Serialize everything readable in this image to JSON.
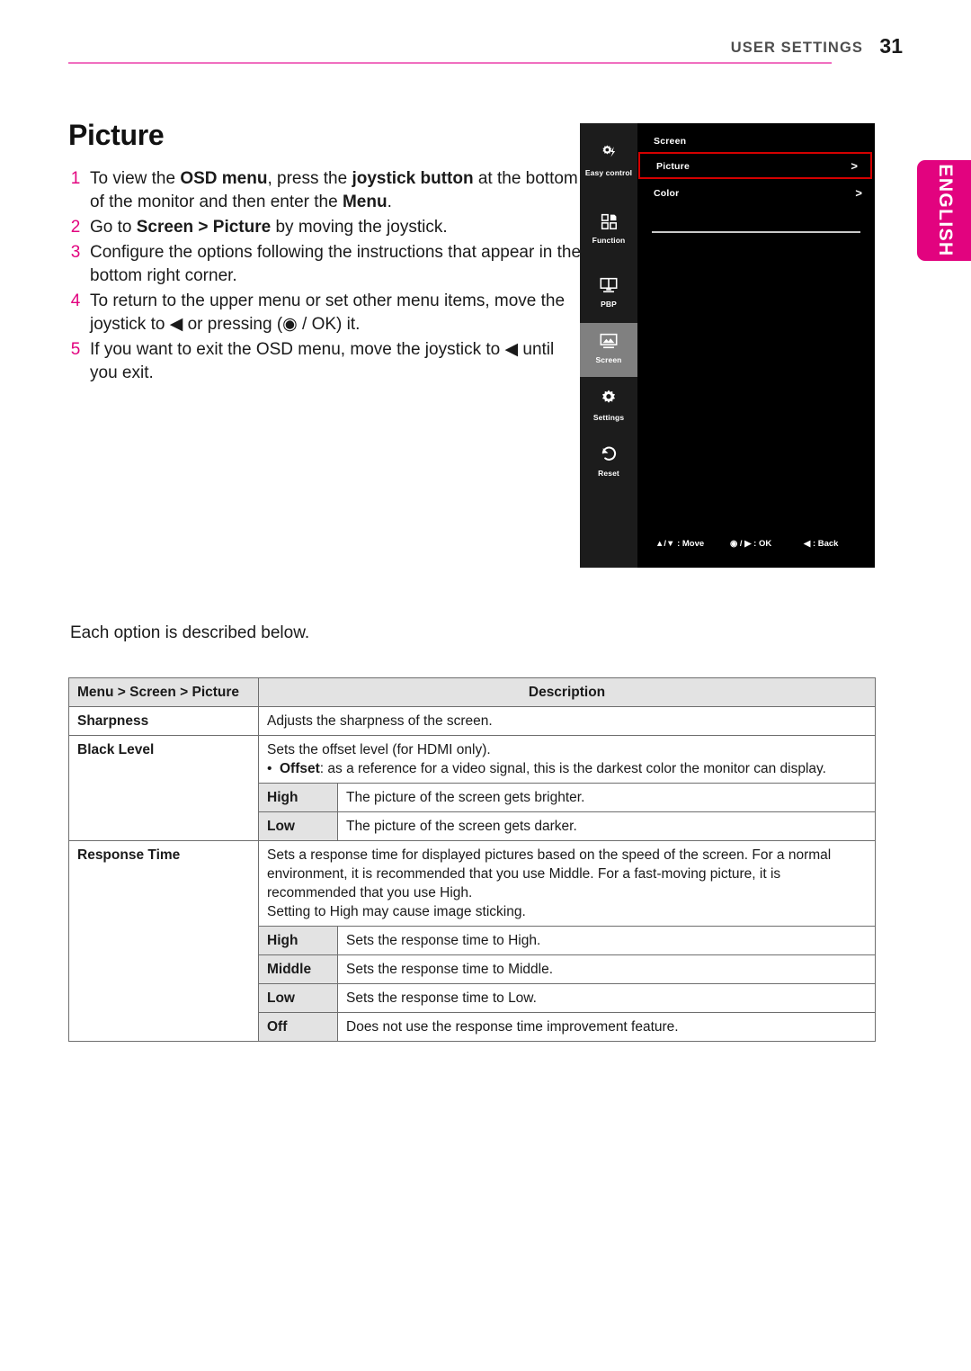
{
  "header": {
    "section_title": "USER SETTINGS",
    "page_number": "31"
  },
  "language_tab": {
    "label": "ENGLISH"
  },
  "document": {
    "heading": "Picture",
    "steps": [
      {
        "num": "1",
        "html": "To view the <b>OSD menu</b>, press the <b>joystick button</b> at the bottom of the monitor and then enter the <b>Menu</b>."
      },
      {
        "num": "2",
        "html": "Go to <b>Screen &gt; Picture</b> by moving the joystick."
      },
      {
        "num": "3",
        "html": "Configure the options following the instructions that appear in the bottom right corner."
      },
      {
        "num": "4",
        "html": "To return to the upper menu or set other menu items, move the joystick to ◀ or pressing (◉ / OK) it."
      },
      {
        "num": "5",
        "html": "If you want to exit the OSD menu, move the joystick to ◀ until you exit."
      }
    ],
    "described_below": "Each option is described below."
  },
  "osd": {
    "sidebar": [
      {
        "label": "Easy control",
        "icon": "easy-control-icon",
        "active": false
      },
      {
        "label": "Function",
        "icon": "function-icon",
        "active": false
      },
      {
        "label": "PBP",
        "icon": "pbp-icon",
        "active": false
      },
      {
        "label": "Screen",
        "icon": "screen-icon",
        "active": true
      },
      {
        "label": "Settings",
        "icon": "settings-gear-icon",
        "active": false
      },
      {
        "label": "Reset",
        "icon": "reset-icon",
        "active": false
      }
    ],
    "menu": {
      "title": "Screen",
      "items": [
        {
          "label": "Picture",
          "arrow": ">",
          "selected": true
        },
        {
          "label": "Color",
          "arrow": ">",
          "selected": false
        }
      ]
    },
    "footer": {
      "move": "▲/▼ : Move",
      "ok": "◉ / ▶ : OK",
      "back": "◀ : Back"
    },
    "highlight_color": "#d40000",
    "active_item_color": "#808080"
  },
  "table": {
    "headers": {
      "option": "Menu > Screen > Picture",
      "description": "Description"
    },
    "rows": [
      {
        "name": "Sharpness",
        "desc": "Adjusts the sharpness of the screen.",
        "bullet_label": "",
        "bullet_text": "",
        "extra_line": "",
        "subrows": []
      },
      {
        "name": "Black Level",
        "desc": "Sets the offset level (for HDMI only).",
        "bullet_label": "Offset",
        "bullet_text": ": as a reference for a video signal, this is the darkest color the monitor can display.",
        "extra_line": "",
        "subrows": [
          {
            "option": "High",
            "desc": "The picture of the screen gets brighter."
          },
          {
            "option": "Low",
            "desc": "The picture of the screen gets darker."
          }
        ]
      },
      {
        "name": "Response Time",
        "desc": "Sets a response time for displayed pictures based on the speed of the screen. For a normal environment, it is recommended that you use Middle. For a fast-moving picture, it is recommended that you use High.",
        "bullet_label": "",
        "bullet_text": "",
        "extra_line": "Setting to High may cause image sticking.",
        "subrows": [
          {
            "option": "High",
            "desc": "Sets the response time to High."
          },
          {
            "option": "Middle",
            "desc": "Sets the response time to Middle."
          },
          {
            "option": "Low",
            "desc": "Sets the response time to Low."
          },
          {
            "option": "Off",
            "desc": "Does not use the response time improvement feature."
          }
        ]
      }
    ]
  }
}
